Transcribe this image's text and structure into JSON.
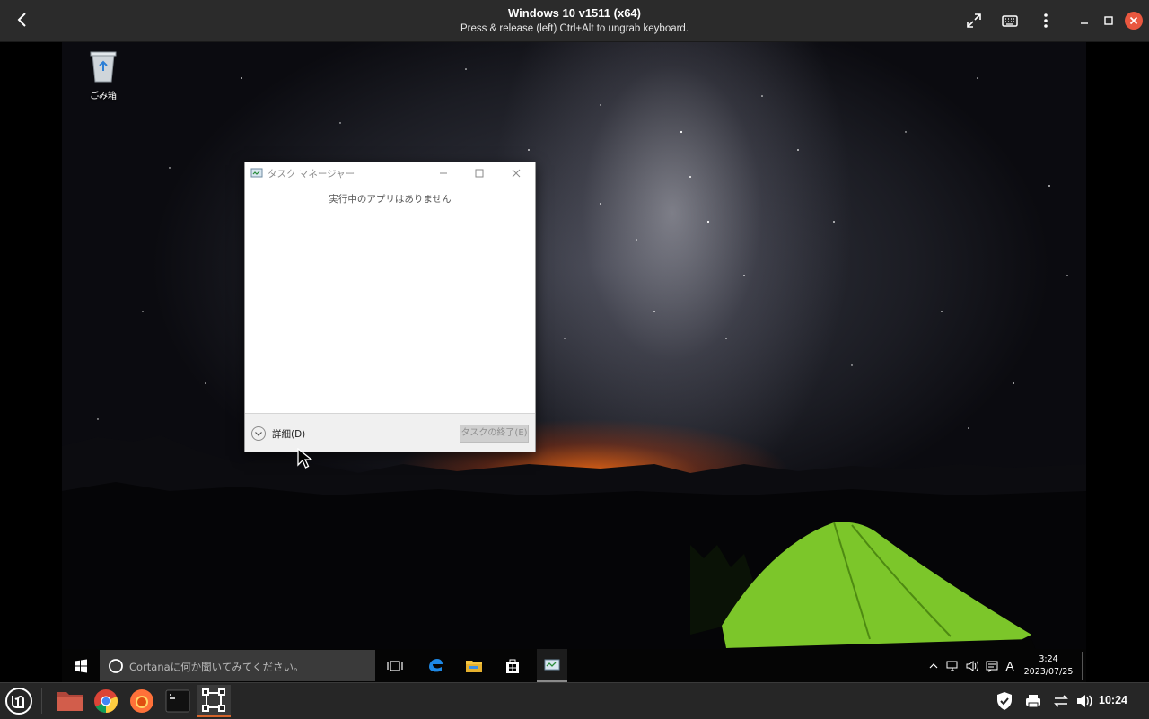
{
  "host": {
    "title": "Windows 10 v1511 (x64)",
    "subtitle": "Press & release (left) Ctrl+Alt to ungrab keyboard.",
    "icons": [
      "back-arrow-icon",
      "fullscreen-icon",
      "keyboard-icon",
      "kebab-menu-icon",
      "minimize-icon",
      "maximize-icon",
      "close-icon"
    ]
  },
  "desktop": {
    "recycle_bin_label": "ごみ箱"
  },
  "task_manager": {
    "title": "タスク マネージャー",
    "empty_message": "実行中のアプリはありません",
    "details_label": "詳細(D)",
    "end_task_label": "タスクの終了(E)"
  },
  "win_taskbar": {
    "search_placeholder": "Cortanaに何か聞いてみてください。",
    "ime_indicator": "A",
    "time": "3:24",
    "date": "2023/07/25",
    "pinned": [
      "windows-start-icon",
      "task-view-icon",
      "edge-icon",
      "file-explorer-icon",
      "store-icon",
      "task-manager-icon"
    ]
  },
  "host_panel": {
    "time": "10:24",
    "apps": [
      "mint-menu-icon",
      "files-icon",
      "chrome-icon",
      "firefox-icon",
      "terminal-icon",
      "vm-viewer-icon"
    ],
    "tray": [
      "shield-icon",
      "printer-icon",
      "network-icon",
      "volume-icon"
    ]
  },
  "colors": {
    "host_close": "#e9573f",
    "panel_accent": "#d4632a",
    "tent_green": "#7cc62a"
  }
}
